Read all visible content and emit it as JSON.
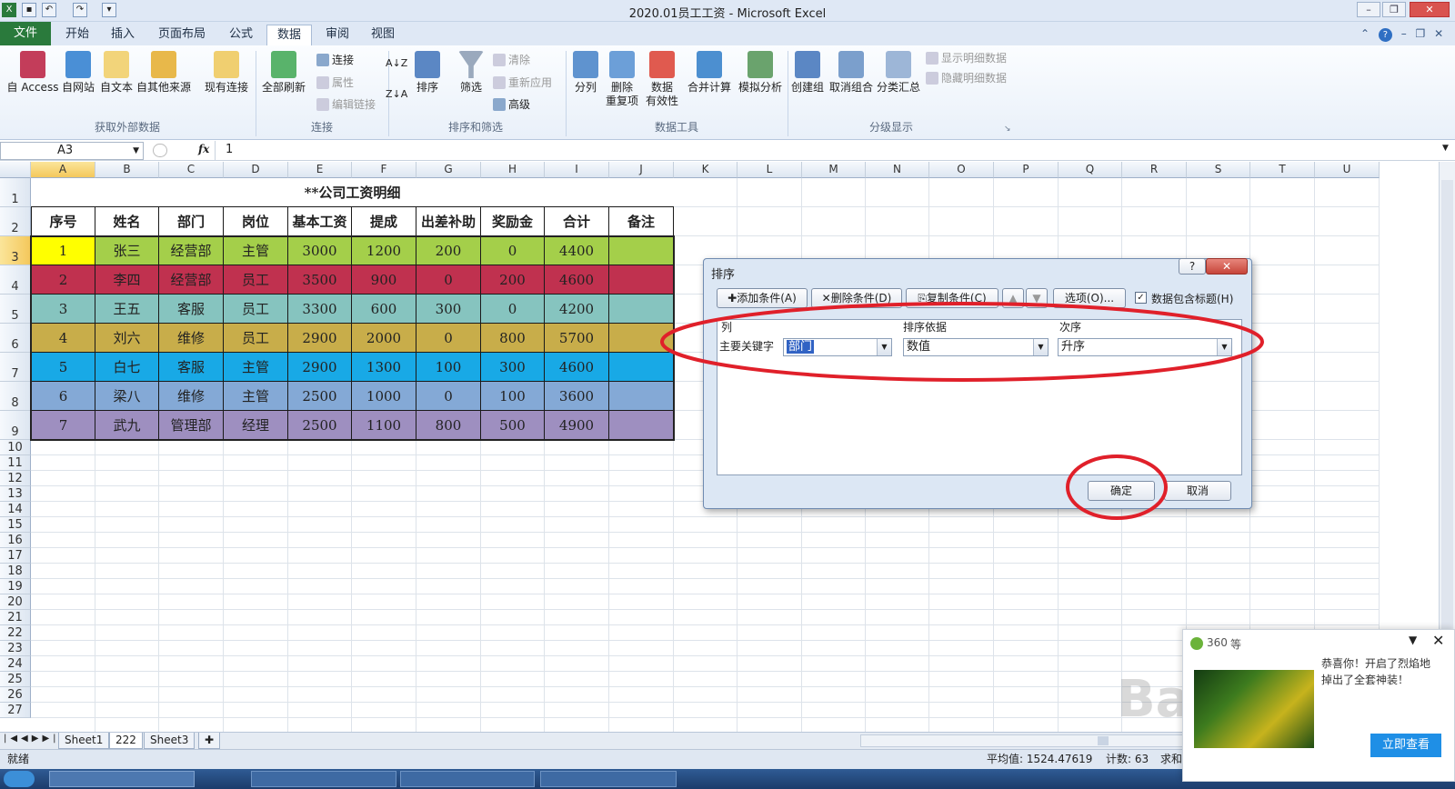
{
  "window": {
    "title": "2020.01员工工资 - Microsoft Excel"
  },
  "tabs": {
    "file": "文件",
    "items": [
      "开始",
      "插入",
      "页面布局",
      "公式",
      "数据",
      "审阅",
      "视图"
    ],
    "active_index": 4
  },
  "ribbon": {
    "external": {
      "access": "自 Access",
      "web": "自网站",
      "text": "自文本",
      "other": "自其他来源",
      "existing": "现有连接",
      "group": "获取外部数据"
    },
    "connections": {
      "refresh": "全部刷新",
      "connections": "连接",
      "properties": "属性",
      "edit_links": "编辑链接",
      "group": "连接"
    },
    "sort": {
      "sort_az": "A↓Z",
      "sort_za": "Z↓A",
      "sort": "排序",
      "filter": "筛选",
      "clear": "清除",
      "reapply": "重新应用",
      "advanced": "高级",
      "group": "排序和筛选"
    },
    "tools": {
      "split": "分列",
      "remove_dup": "删除\n重复项",
      "validation": "数据\n有效性",
      "consolidate": "合并计算",
      "whatif": "模拟分析",
      "group": "数据工具"
    },
    "outline": {
      "group_btn": "创建组",
      "ungroup": "取消组合",
      "subtotal": "分类汇总",
      "show_detail": "显示明细数据",
      "hide_detail": "隐藏明细数据",
      "group": "分级显示"
    }
  },
  "formula_bar": {
    "name_box": "A3",
    "fx": "fx",
    "value": "1"
  },
  "columns": [
    "A",
    "B",
    "C",
    "D",
    "E",
    "F",
    "G",
    "H",
    "I",
    "J",
    "K",
    "L",
    "M",
    "N",
    "O",
    "P",
    "Q",
    "R",
    "S",
    "T",
    "U"
  ],
  "rows": [
    "1",
    "2",
    "3",
    "4",
    "5",
    "6",
    "7",
    "8",
    "9",
    "10",
    "11",
    "12",
    "13",
    "14",
    "15",
    "16",
    "17",
    "18",
    "19",
    "20",
    "21",
    "22",
    "23",
    "24",
    "25",
    "26",
    "27"
  ],
  "sheet": {
    "title": "**公司工资明细",
    "headers": [
      "序号",
      "姓名",
      "部门",
      "岗位",
      "基本工资",
      "提成",
      "出差补助",
      "奖励金",
      "合计",
      "备注"
    ],
    "rows": [
      {
        "cells": [
          "1",
          "张三",
          "经营部",
          "主管",
          "3000",
          "1200",
          "200",
          "0",
          "4400",
          ""
        ],
        "color": "#a4cf4a",
        "first_color": "#ffff00"
      },
      {
        "cells": [
          "2",
          "李四",
          "经营部",
          "员工",
          "3500",
          "900",
          "0",
          "200",
          "4600",
          ""
        ],
        "color": "#c0314f",
        "first_color": "#c0314f"
      },
      {
        "cells": [
          "3",
          "王五",
          "客服",
          "员工",
          "3300",
          "600",
          "300",
          "0",
          "4200",
          ""
        ],
        "color": "#86c4bf",
        "first_color": "#86c4bf"
      },
      {
        "cells": [
          "4",
          "刘六",
          "维修",
          "员工",
          "2900",
          "2000",
          "0",
          "800",
          "5700",
          ""
        ],
        "color": "#c8ad4a",
        "first_color": "#c8ad4a"
      },
      {
        "cells": [
          "5",
          "白七",
          "客服",
          "主管",
          "2900",
          "1300",
          "100",
          "300",
          "4600",
          ""
        ],
        "color": "#18a9e6",
        "first_color": "#18a9e6"
      },
      {
        "cells": [
          "6",
          "梁八",
          "维修",
          "主管",
          "2500",
          "1000",
          "0",
          "100",
          "3600",
          ""
        ],
        "color": "#84a9d6",
        "first_color": "#84a9d6"
      },
      {
        "cells": [
          "7",
          "武九",
          "管理部",
          "经理",
          "2500",
          "1100",
          "800",
          "500",
          "4900",
          ""
        ],
        "color": "#9e8fc0",
        "first_color": "#9e8fc0"
      }
    ]
  },
  "dialog": {
    "title": "排序",
    "help": "?",
    "close": "✕",
    "add": "添加条件(A)",
    "delete": "删除条件(D)",
    "copy": "复制条件(C)",
    "options": "选项(O)...",
    "has_header": "数据包含标题(H)",
    "col_header": "列",
    "sort_on_header": "排序依据",
    "order_header": "次序",
    "primary_key": "主要关键字",
    "column_value": "部门",
    "sort_on_value": "数值",
    "order_value": "升序",
    "ok": "确定",
    "cancel": "取消"
  },
  "sheet_tabs": [
    "Sheet1",
    "222",
    "Sheet3"
  ],
  "status": {
    "ready": "就绪",
    "average": "平均值: 1524.47619",
    "count": "计数: 63",
    "sum": "求和"
  },
  "popup": {
    "brand": "360",
    "extra": "等",
    "line1": "恭喜你！开启了烈焰地",
    "line2": "掉出了全套神装！",
    "button": "立即查看"
  },
  "watermark": "Bai du 经验 jingyan.baidu.com",
  "colors": {
    "ribbon_bg": "#e9f0f9",
    "file_tab": "#2a7a3c",
    "annotation_red": "#e0202a",
    "selection_header": "#f4c85c"
  }
}
